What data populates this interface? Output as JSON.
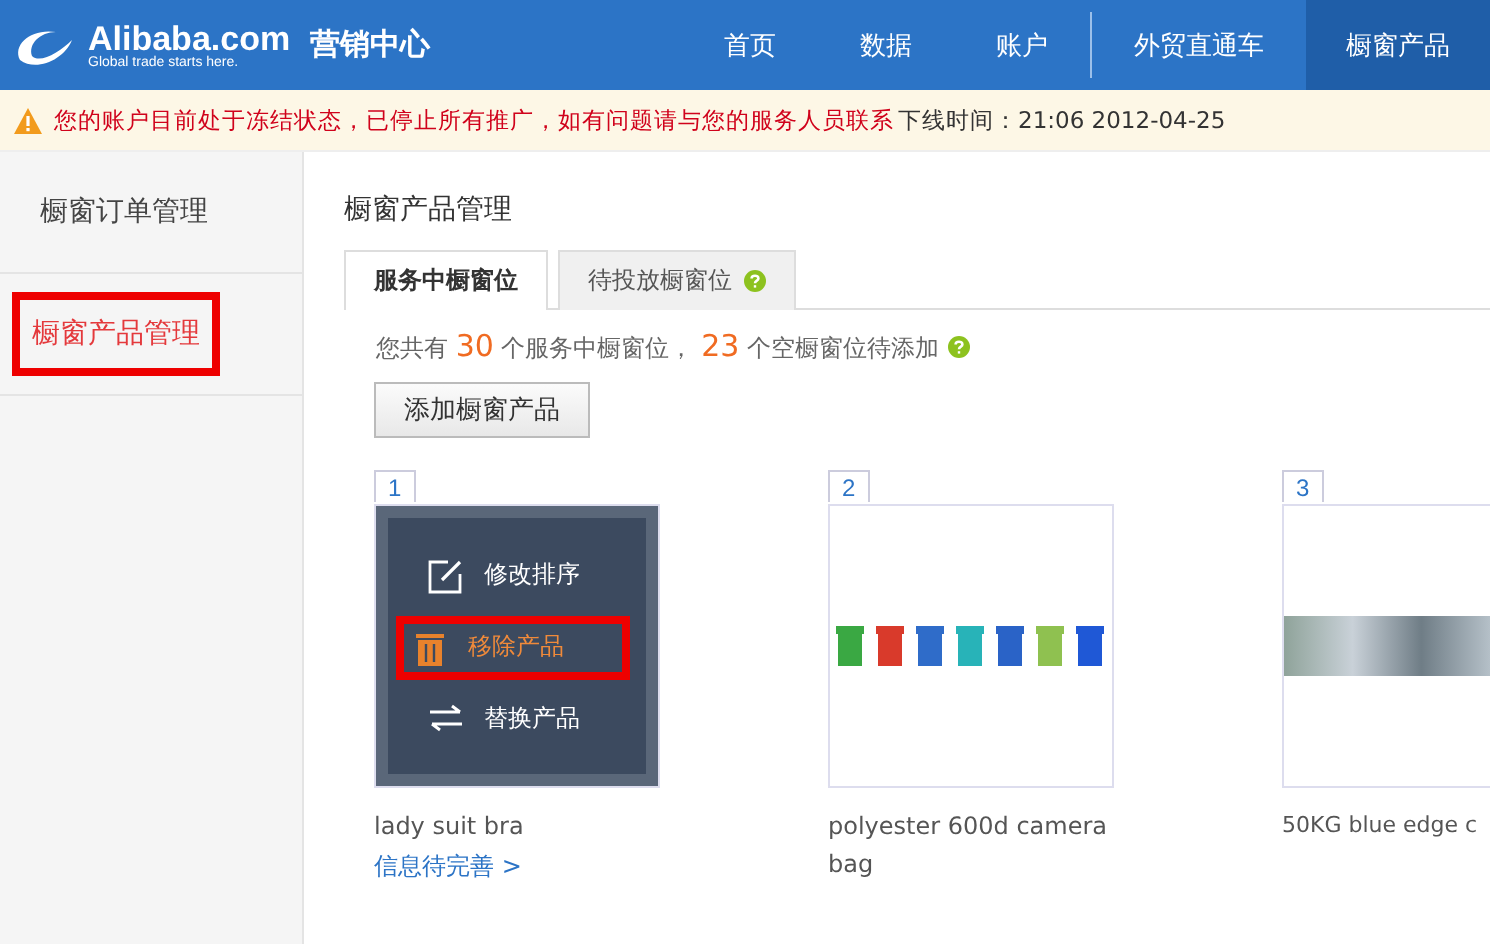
{
  "header": {
    "logo_name": "Alibaba.com",
    "logo_tagline": "Global trade starts here.",
    "section": "营销中心",
    "nav": [
      {
        "label": "首页",
        "selected": false
      },
      {
        "label": "数据",
        "selected": false
      },
      {
        "label": "账户",
        "selected": false
      },
      {
        "label": "外贸直通车",
        "selected": false
      },
      {
        "label": "橱窗产品",
        "selected": true
      }
    ]
  },
  "notice": {
    "message": "您的账户目前处于冻结状态，已停止所有推广，如有问题请与您的服务人员联系",
    "offline_label": "下线时间：21:06 2012-04-25"
  },
  "sidebar": {
    "items": [
      {
        "label": "橱窗订单管理",
        "selected": false,
        "highlighted": false
      },
      {
        "label": "橱窗产品管理",
        "selected": true,
        "highlighted": true
      }
    ]
  },
  "main": {
    "title": "橱窗产品管理",
    "tabs": [
      {
        "label": "服务中橱窗位",
        "selected": true,
        "help": false
      },
      {
        "label": "待投放橱窗位",
        "selected": false,
        "help": true
      }
    ],
    "summary": {
      "prefix": "您共有",
      "in_service": "30",
      "middle": "个服务中橱窗位，",
      "empty": "23",
      "suffix": "个空橱窗位待添加"
    },
    "add_button": "添加橱窗产品",
    "products": [
      {
        "number": "1",
        "kind": "menu",
        "title": "lady suit bra",
        "link": "信息待完善 >",
        "menu": [
          {
            "kind": "edit",
            "label": "修改排序",
            "highlighted": false
          },
          {
            "kind": "remove",
            "label": "移除产品",
            "highlighted": true
          },
          {
            "kind": "replace",
            "label": "替换产品",
            "highlighted": false
          }
        ]
      },
      {
        "number": "2",
        "kind": "bins",
        "title": "polyester 600d camera bag"
      },
      {
        "number": "3",
        "kind": "photos",
        "title": "50KG blue edge c"
      }
    ]
  }
}
